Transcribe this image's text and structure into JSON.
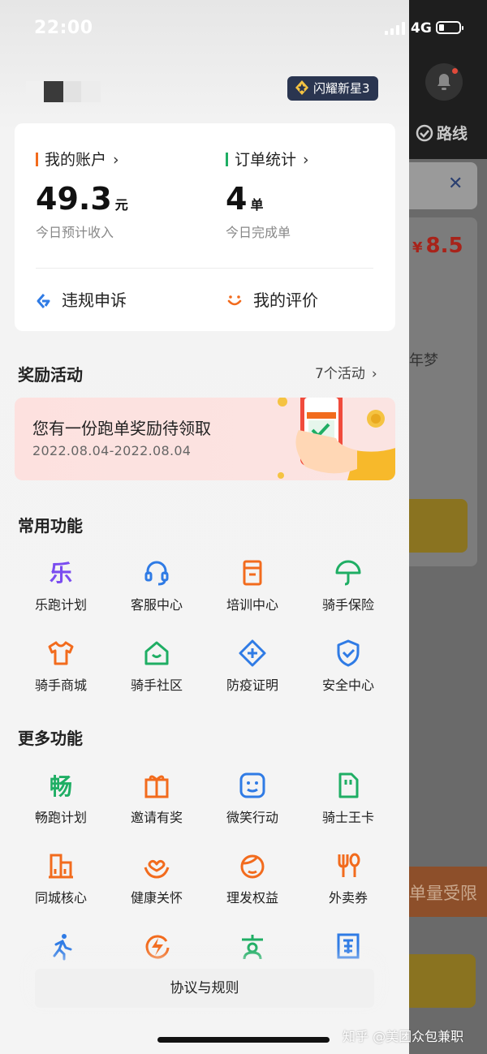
{
  "status_bar": {
    "time": "22:00",
    "network": "4G",
    "battery_level": 0.25
  },
  "header": {
    "badge_label": "闪耀新星3"
  },
  "account_card": {
    "account": {
      "title": "我的账户",
      "value": "49.3",
      "unit": "元",
      "desc": "今日预计收入",
      "accent": "#f26b1d"
    },
    "orders": {
      "title": "订单统计",
      "value": "4",
      "unit": "单",
      "desc": "今日完成单",
      "accent": "#1fae64"
    },
    "appeal_label": "违规申诉",
    "review_label": "我的评价"
  },
  "rewards": {
    "title": "奖励活动",
    "more_label": "7个活动",
    "banner_title": "您有一份跑单奖励待领取",
    "banner_date": "2022.08.04-2022.08.04"
  },
  "common_functions": {
    "title": "常用功能",
    "items": [
      {
        "label": "乐跑计划",
        "icon": "le-icon"
      },
      {
        "label": "客服中心",
        "icon": "headset-icon"
      },
      {
        "label": "培训中心",
        "icon": "book-icon"
      },
      {
        "label": "骑手保险",
        "icon": "umbrella-icon"
      },
      {
        "label": "骑手商城",
        "icon": "shirt-icon"
      },
      {
        "label": "骑手社区",
        "icon": "home-icon"
      },
      {
        "label": "防疫证明",
        "icon": "medical-icon"
      },
      {
        "label": "安全中心",
        "icon": "shield-icon"
      }
    ]
  },
  "more_functions": {
    "title": "更多功能",
    "items": [
      {
        "label": "畅跑计划",
        "icon": "chang-icon"
      },
      {
        "label": "邀请有奖",
        "icon": "gift-icon"
      },
      {
        "label": "微笑行动",
        "icon": "smile-icon"
      },
      {
        "label": "骑士王卡",
        "icon": "simcard-icon"
      },
      {
        "label": "同城核心",
        "icon": "building-icon"
      },
      {
        "label": "健康关怀",
        "icon": "heart-hands-icon"
      },
      {
        "label": "理发权益",
        "icon": "haircut-icon"
      },
      {
        "label": "外卖券",
        "icon": "fork-spoon-icon"
      },
      {
        "label": "",
        "icon": "runner-icon"
      },
      {
        "label": "",
        "icon": "energy-icon"
      },
      {
        "label": "",
        "icon": "person-icon"
      },
      {
        "label": "",
        "icon": "receipt-icon"
      }
    ]
  },
  "footer": {
    "rules_label": "协议与规则"
  },
  "background_screen": {
    "route_label": "路线",
    "price": "8.5",
    "currency": "¥",
    "name_fragment": "年梦",
    "limit_label": "单量受限"
  },
  "watermark": "知乎 @美团众包兼职",
  "colors": {
    "orange": "#f26b1d",
    "green": "#1fae64",
    "blue": "#2f7be5",
    "purple": "#7a4cf0",
    "badge_bg": "#2a3550"
  }
}
